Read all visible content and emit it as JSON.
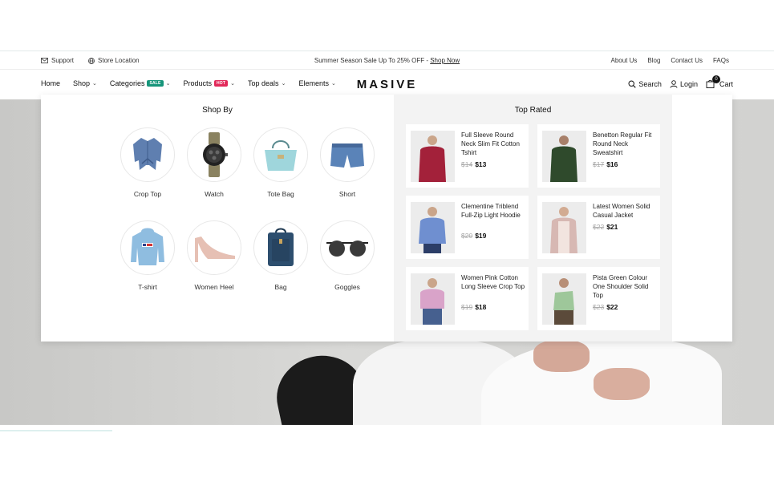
{
  "topbar": {
    "support": "Support",
    "store_location": "Store Location",
    "promo_text": "Summer Season Sale Up To 25% OFF - ",
    "promo_link": "Shop Now",
    "links": [
      "About Us",
      "Blog",
      "Contact Us",
      "FAQs"
    ]
  },
  "nav": {
    "items": [
      {
        "label": "Home",
        "badge": "",
        "has_dropdown": false
      },
      {
        "label": "Shop",
        "badge": "",
        "has_dropdown": true
      },
      {
        "label": "Categories",
        "badge": "SALE",
        "has_dropdown": true
      },
      {
        "label": "Products",
        "badge": "HOT",
        "has_dropdown": true
      },
      {
        "label": "Top deals",
        "badge": "",
        "has_dropdown": true
      },
      {
        "label": "Elements",
        "badge": "",
        "has_dropdown": true
      }
    ],
    "logo": "MASIVE",
    "search": "Search",
    "login": "Login",
    "cart": "Cart",
    "cart_count": "0"
  },
  "shop_by": {
    "title": "Shop By",
    "categories": [
      {
        "label": "Crop Top",
        "icon": "denim-shirt-icon"
      },
      {
        "label": "Watch",
        "icon": "watch-icon"
      },
      {
        "label": "Tote Bag",
        "icon": "tote-bag-icon"
      },
      {
        "label": "Short",
        "icon": "shorts-icon"
      },
      {
        "label": "T-shirt",
        "icon": "hoodie-icon"
      },
      {
        "label": "Women Heel",
        "icon": "heel-icon"
      },
      {
        "label": "Bag",
        "icon": "backpack-icon"
      },
      {
        "label": "Goggles",
        "icon": "sunglasses-icon"
      }
    ]
  },
  "top_rated": {
    "title": "Top Rated",
    "products": [
      {
        "name": "Full Sleeve Round Neck Slim Fit Cotton Tshirt",
        "old_price": "$14",
        "price": "$13",
        "color": "#a3213a"
      },
      {
        "name": "Benetton Regular Fit Round Neck Sweatshirt",
        "old_price": "$17",
        "price": "$16",
        "color": "#2f4a2c"
      },
      {
        "name": "Clementine Triblend Full-Zip Light Hoodie",
        "old_price": "$20",
        "price": "$19",
        "color": "#6f8fd0"
      },
      {
        "name": "Latest Women Solid Casual Jacket",
        "old_price": "$22",
        "price": "$21",
        "color": "#d7b8b3"
      },
      {
        "name": "Women Pink Cotton Long Sleeve Crop Top",
        "old_price": "$19",
        "price": "$18",
        "color": "#d9a3c9"
      },
      {
        "name": "Pista Green Colour One Shoulder Solid Top",
        "old_price": "$23",
        "price": "$22",
        "color": "#9ec79a"
      }
    ]
  },
  "colors": {
    "sale_badge": "#16957a",
    "hot_badge": "#e2295a",
    "panel_bg": "#f3f3f3"
  }
}
